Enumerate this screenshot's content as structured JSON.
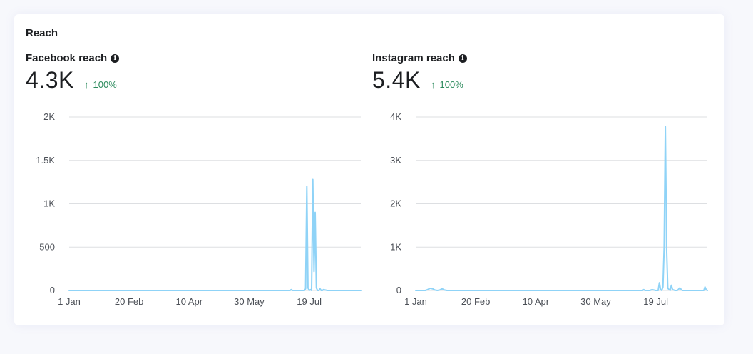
{
  "section_title": "Reach",
  "info_icon_glyph": "i",
  "arrow_glyph": "↑",
  "colors": {
    "line": "#8fd3f7",
    "grid": "#dddfe2",
    "positive": "#2b8a5c",
    "text": "#1c1e21"
  },
  "panels": [
    {
      "label": "Facebook reach",
      "value": "4.3K",
      "change": "100%",
      "icon": "info-icon"
    },
    {
      "label": "Instagram reach",
      "value": "5.4K",
      "change": "100%",
      "icon": "info-icon"
    }
  ],
  "chart_data": [
    {
      "type": "line",
      "title": "",
      "xlabel": "",
      "ylabel": "",
      "ylim": [
        0,
        2000
      ],
      "yticks": [
        0,
        500,
        1000,
        1500,
        2000
      ],
      "ytick_labels": [
        "0",
        "500",
        "1K",
        "1.5K",
        "2K"
      ],
      "xlim": [
        0,
        243
      ],
      "xticks": [
        0,
        50,
        100,
        150,
        200
      ],
      "xtick_labels": [
        "1 Jan",
        "20 Feb",
        "10 Apr",
        "30 May",
        "19 Jul"
      ],
      "grid": true,
      "series": [
        {
          "x": [
            0,
            184,
            185,
            186,
            196,
            197,
            198,
            199,
            200,
            201,
            202,
            203,
            204,
            205,
            206,
            207,
            208,
            209,
            210,
            211,
            212,
            215,
            217,
            220,
            243
          ],
          "values": [
            0,
            0,
            10,
            0,
            0,
            20,
            1200,
            30,
            0,
            10,
            0,
            1280,
            220,
            900,
            30,
            0,
            0,
            20,
            0,
            0,
            10,
            0,
            0,
            0,
            0
          ]
        }
      ]
    },
    {
      "type": "line",
      "title": "",
      "xlabel": "",
      "ylabel": "",
      "ylim": [
        0,
        4000
      ],
      "yticks": [
        0,
        1000,
        2000,
        3000,
        4000
      ],
      "ytick_labels": [
        "0",
        "1K",
        "2K",
        "3K",
        "4K"
      ],
      "xlim": [
        0,
        243
      ],
      "xticks": [
        0,
        50,
        100,
        150,
        200
      ],
      "xtick_labels": [
        "1 Jan",
        "20 Feb",
        "10 Apr",
        "30 May",
        "19 Jul"
      ],
      "grid": true,
      "series": [
        {
          "x": [
            0,
            8,
            10,
            12,
            14,
            16,
            18,
            20,
            22,
            24,
            26,
            50,
            100,
            185,
            189,
            190,
            191,
            195,
            197,
            200,
            202,
            203,
            204,
            205,
            206,
            207,
            208,
            209,
            210,
            212,
            213,
            214,
            216,
            218,
            220,
            222,
            224,
            230,
            240,
            241,
            242,
            243
          ],
          "values": [
            0,
            0,
            20,
            50,
            40,
            10,
            0,
            10,
            40,
            10,
            0,
            0,
            0,
            0,
            0,
            20,
            0,
            0,
            20,
            0,
            0,
            180,
            20,
            0,
            80,
            1000,
            3780,
            1000,
            50,
            0,
            120,
            20,
            0,
            0,
            60,
            0,
            0,
            0,
            0,
            80,
            20,
            0
          ]
        }
      ]
    }
  ]
}
